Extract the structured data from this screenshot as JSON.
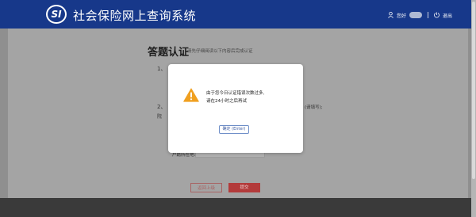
{
  "header": {
    "logo_text": "SI",
    "title": "社会保险网上查询系统",
    "user_prefix": "您好",
    "logout_label": "退出"
  },
  "page": {
    "section_title": "答题认证",
    "section_hint": "请先仔细阅读以下内容后完成认证",
    "q1_number": "1、",
    "q2_number": "2、",
    "q2_tail_a": "(请填写);",
    "q2_prefix": "院",
    "select_label": "户籍所在地:",
    "back_button": "返回上级",
    "submit_button": "提交"
  },
  "dialog": {
    "message_line1": "由于您今日认证错误次数过多,",
    "message_line2": "请在24小时之后再试",
    "ok_button": "确定 (Enter)"
  },
  "colors": {
    "header_bg": "#17388a",
    "overlay_bg": "#a4a4a4",
    "warning": "#f0a020",
    "submit": "#b33b3b"
  }
}
